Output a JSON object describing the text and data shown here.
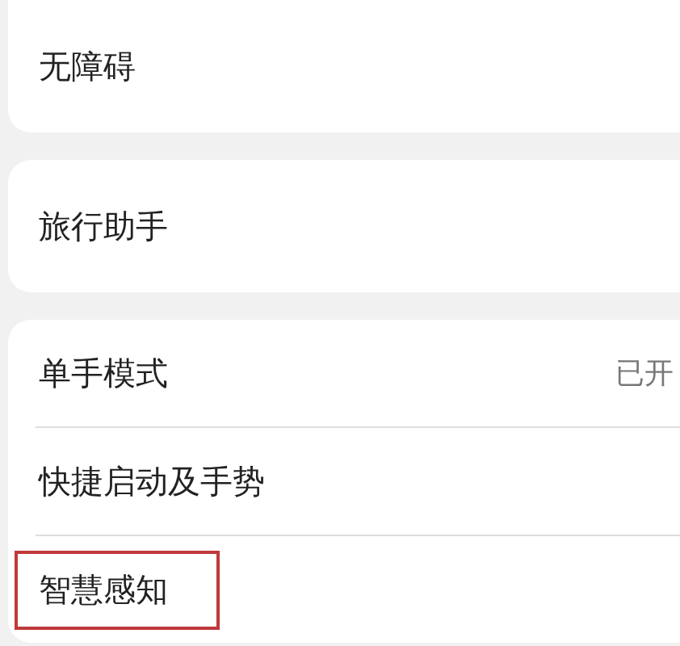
{
  "groups": [
    {
      "items": [
        {
          "label": "无障碍",
          "highlighted": false
        }
      ]
    },
    {
      "items": [
        {
          "label": "旅行助手",
          "highlighted": false
        }
      ]
    },
    {
      "items": [
        {
          "label": "单手模式",
          "value": "已开",
          "highlighted": false
        },
        {
          "label": "快捷启动及手势",
          "highlighted": false
        },
        {
          "label": "智慧感知",
          "highlighted": true
        }
      ]
    }
  ]
}
